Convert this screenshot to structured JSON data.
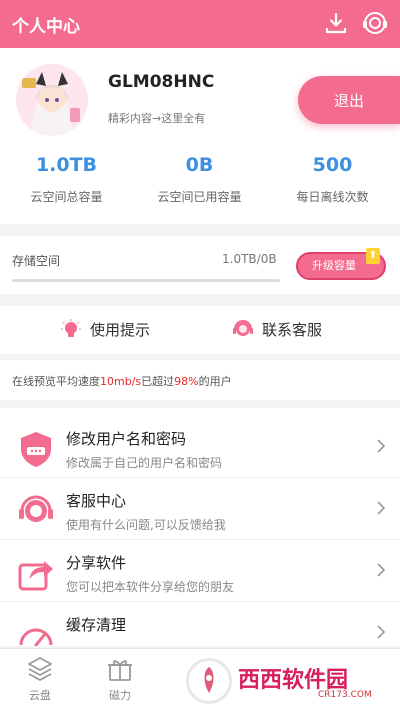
{
  "header": {
    "title": "个人中心"
  },
  "profile": {
    "username": "GLM08HNC",
    "subtitle": "精彩内容→这里全有",
    "logout_label": "退出"
  },
  "stats": [
    {
      "value": "1.0TB",
      "label": "云空间总容量"
    },
    {
      "value": "0B",
      "label": "云空间已用容量"
    },
    {
      "value": "500",
      "label": "每日离线次数"
    }
  ],
  "storage": {
    "label": "存储空间",
    "value": "1.0TB/0B",
    "used_fraction": 0,
    "upgrade_label": "升级容量"
  },
  "help": {
    "tips_label": "使用提示",
    "contact_label": "联系客服"
  },
  "speed": {
    "prefix": "在线预览平均速度",
    "speed": "10mb/s",
    "middle": "已超过",
    "percent": "98%",
    "suffix": "的用户"
  },
  "menu": [
    {
      "title": "修改用户名和密码",
      "desc": "修改属于自己的用户名和密码"
    },
    {
      "title": "客服中心",
      "desc": "使用有什么问题,可以反馈给我"
    },
    {
      "title": "分享软件",
      "desc": "您可以把本软件分享给您的朋友"
    },
    {
      "title": "缓存清理",
      "desc": ""
    }
  ],
  "tabs": [
    {
      "label": "云盘",
      "icon": "layers-icon"
    },
    {
      "label": "磁力",
      "icon": "gift-icon"
    }
  ],
  "watermark": {
    "text": "西西软件园",
    "site": "CR173.COM"
  },
  "colors": {
    "accent": "#f36b8e",
    "value_blue": "#3d8fe0",
    "highlight_red": "#e52a2a"
  }
}
